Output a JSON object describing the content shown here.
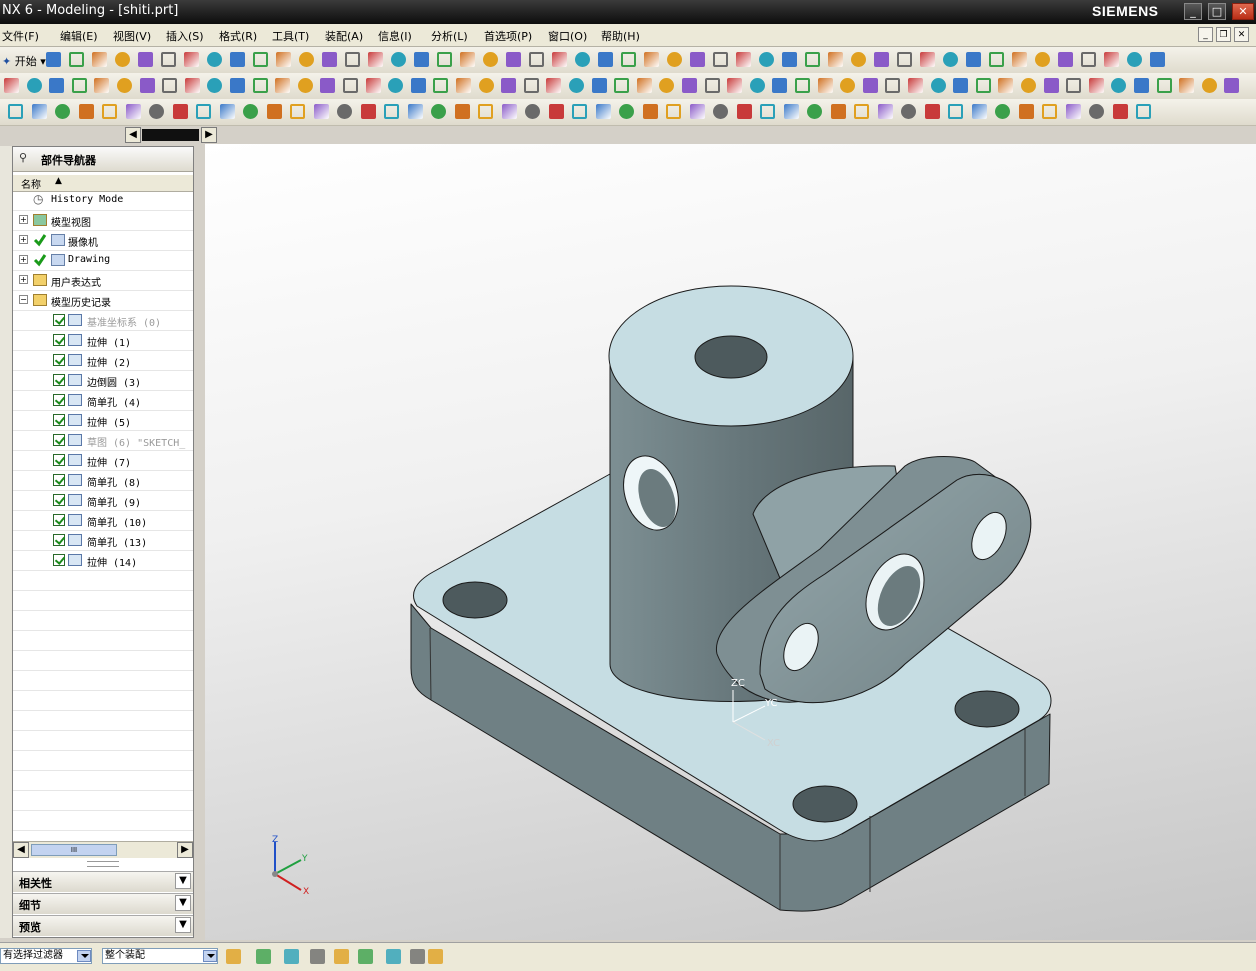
{
  "window": {
    "title": "NX 6 - Modeling - [shiti.prt]",
    "brand": "SIEMENS",
    "min": "_",
    "max": "□",
    "close": "✕"
  },
  "menu": [
    "文件(F)",
    "编辑(E)",
    "视图(V)",
    "插入(S)",
    "格式(R)",
    "工具(T)",
    "装配(A)",
    "信息(I)",
    "分析(L)",
    "首选项(P)",
    "窗口(O)",
    "帮助(H)"
  ],
  "toolbar": {
    "start_label": "开始"
  },
  "nav": {
    "title": "部件导航器",
    "column_name": "名称",
    "rows": [
      {
        "label": "History Mode",
        "dim": false
      },
      {
        "label": "模型视图",
        "dim": false
      },
      {
        "label": "摄像机",
        "dim": false
      },
      {
        "label": "Drawing",
        "dim": false
      },
      {
        "label": "用户表达式",
        "dim": false
      },
      {
        "label": "模型历史记录",
        "dim": false
      },
      {
        "label": "基准坐标系 (0)",
        "dim": true
      },
      {
        "label": "拉伸 (1)",
        "dim": false
      },
      {
        "label": "拉伸 (2)",
        "dim": false
      },
      {
        "label": "边倒圆 (3)",
        "dim": false
      },
      {
        "label": "简单孔 (4)",
        "dim": false
      },
      {
        "label": "拉伸 (5)",
        "dim": false
      },
      {
        "label": "草图 (6) \"SKETCH_",
        "dim": true
      },
      {
        "label": "拉伸 (7)",
        "dim": false
      },
      {
        "label": "简单孔 (8)",
        "dim": false
      },
      {
        "label": "简单孔 (9)",
        "dim": false
      },
      {
        "label": "简单孔 (10)",
        "dim": false
      },
      {
        "label": "简单孔 (13)",
        "dim": false
      },
      {
        "label": "拉伸 (14)",
        "dim": false
      }
    ],
    "hscroll_grip": "III"
  },
  "panels": [
    "相关性",
    "细节",
    "预览"
  ],
  "viewport": {
    "part_axes": {
      "zc": "ZC",
      "yc": "YC",
      "xc": "XC"
    },
    "triad": {
      "z": "Z",
      "y": "Y",
      "x": "X"
    }
  },
  "status": {
    "filter": "有选择过滤器",
    "scope": "整个装配"
  },
  "colors": {
    "model_face_light": "#c6dde3",
    "model_face_dark": "#6b7b7e",
    "model_edge": "#1a1a1a",
    "title_bg": "#111111",
    "check_green": "#1a8a1a"
  }
}
